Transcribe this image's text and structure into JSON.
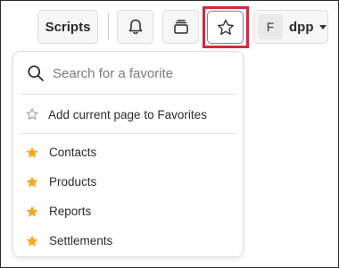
{
  "toolbar": {
    "scripts_label": "Scripts",
    "user_initial": "F",
    "username": "dpp"
  },
  "favorites_menu": {
    "search_placeholder": "Search for a favorite",
    "add_label": "Add current page to Favorites",
    "items": [
      {
        "label": "Contacts"
      },
      {
        "label": "Products"
      },
      {
        "label": "Reports"
      },
      {
        "label": "Settlements"
      }
    ]
  },
  "colors": {
    "highlight_border": "#d7263d",
    "star_filled": "#f5a623",
    "active_button_border": "#6f7bd8"
  },
  "icons": [
    "bell-icon",
    "cards-icon",
    "star-outline-icon",
    "search-icon",
    "star-filled-icon",
    "chevron-down-icon"
  ]
}
